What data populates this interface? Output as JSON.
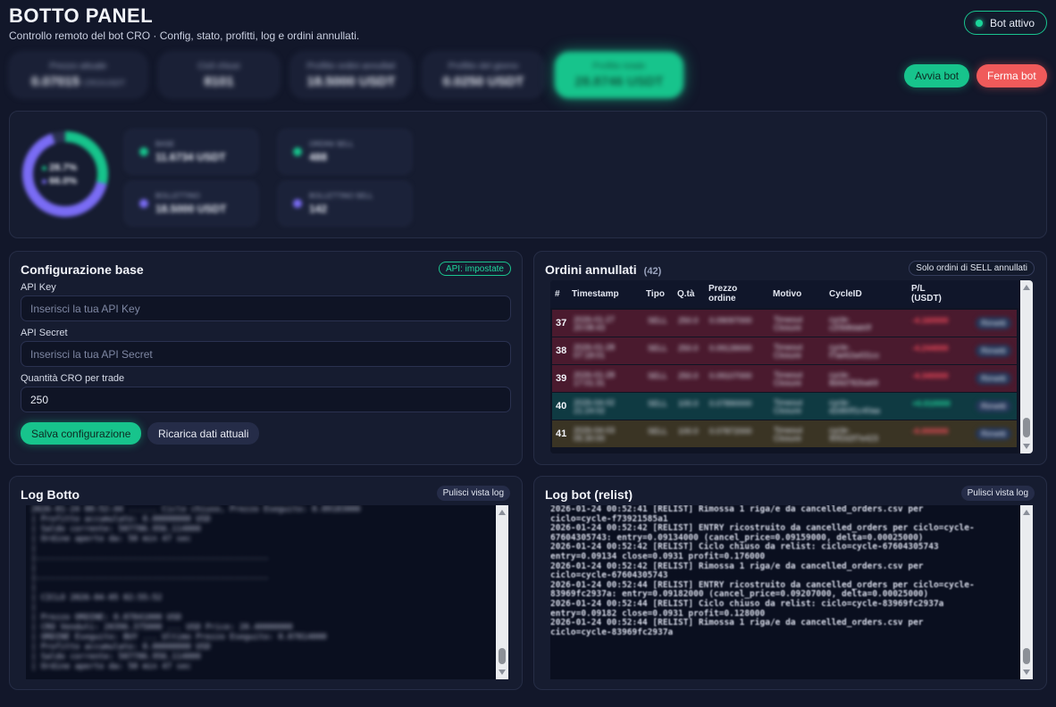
{
  "header": {
    "title": "BOTTO PANEL",
    "subtitle": "Controllo remoto del bot CRO · Config, stato, profitti, log e ordini annullati.",
    "status_label": "Bot attivo"
  },
  "stats": [
    {
      "label": "Prezzo attuale",
      "value": "0.07015",
      "unit": "CRO/USDT",
      "highlight": false
    },
    {
      "label": "Cicli chiusi",
      "value": "8101",
      "unit": "",
      "highlight": false
    },
    {
      "label": "Profitto ordini annullati",
      "value": "18.5000 USDT",
      "unit": "",
      "highlight": false
    },
    {
      "label": "Profitto del giorno",
      "value": "0.0250 USDT",
      "unit": "",
      "highlight": false
    },
    {
      "label": "Profitto totale",
      "value": "28.8746 USDT",
      "unit": "",
      "highlight": true
    }
  ],
  "actions": {
    "start_label": "Avvia bot",
    "stop_label": "Ferma bot"
  },
  "distribution": {
    "pct_a": "28.7%",
    "pct_b": "66.0%",
    "fraction_a": 0.287,
    "fraction_b": 0.66,
    "cards": [
      {
        "label": "BASE",
        "value": "11.6734 USDT",
        "color": "#17c48c"
      },
      {
        "label": "ORDINI SELL",
        "value": "488",
        "color": "#17c48c"
      },
      {
        "label": "BOLLETTINO",
        "value": "18.5000 USDT",
        "color": "#7a6cf5"
      },
      {
        "label": "BOLLETTINO SELL",
        "value": "142",
        "color": "#7a6cf5"
      }
    ]
  },
  "config": {
    "title": "Configurazione base",
    "api_badge": "API: impostate",
    "api_key_label": "API Key",
    "api_key_placeholder": "Inserisci la tua API Key",
    "api_secret_label": "API Secret",
    "api_secret_placeholder": "Inserisci la tua API Secret",
    "qty_label": "Quantità CRO per trade",
    "qty_value": "250",
    "save_label": "Salva configurazione",
    "reload_label": "Ricarica dati attuali"
  },
  "orders": {
    "title": "Ordini annullati",
    "count": "(42)",
    "filter_label": "Solo ordini di SELL annullati",
    "columns": [
      "#",
      "Timestamp",
      "Tipo",
      "Q.tà",
      "Prezzo ordine",
      "Motivo",
      "CycleID",
      "P/L (USDT)"
    ],
    "rows": [
      {
        "id": "37",
        "ts": "2026-01-27 20:08:43",
        "tipo": "SELL",
        "qty": "250.0",
        "price": "0.09097000",
        "motivo": "Timeout Closure",
        "cycle": "cycle-c20b8dab0f",
        "pl": "-4.160000",
        "action": "Rimetti",
        "bg": "#4a1a2e",
        "pl_color": "#ff4d5e"
      },
      {
        "id": "38",
        "ts": "2026-01-28 07:18:01",
        "tipo": "SELL",
        "qty": "250.0",
        "price": "0.09139000",
        "motivo": "Timeout Closure",
        "cycle": "cycle-f7ae62a431cc",
        "pl": "-4.244000",
        "action": "Rimetti",
        "bg": "#4a1a2e",
        "pl_color": "#ff4d5e"
      },
      {
        "id": "39",
        "ts": "2026-01-28 17:01:31",
        "tipo": "SELL",
        "qty": "250.0",
        "price": "0.09107000",
        "motivo": "Timeout Closure",
        "cycle": "cycle-8d4d782ba69",
        "pl": "-4.340000",
        "action": "Rimetti",
        "bg": "#4a1a2e",
        "pl_color": "#ff4d5e"
      },
      {
        "id": "40",
        "ts": "2026-04-02 21:24:02",
        "tipo": "SELL",
        "qty": "100.0",
        "price": "0.07890000",
        "motivo": "Timeout Closure",
        "cycle": "cycle-d2d60f1c40aa",
        "pl": "+0.010000",
        "action": "Rimetti",
        "bg": "#0f3a42",
        "pl_color": "#22e0a0"
      },
      {
        "id": "41",
        "ts": "2026-04-03 05:30:00",
        "tipo": "SELL",
        "qty": "100.0",
        "price": "0.07872000",
        "motivo": "Timeout Closure",
        "cycle": "cycle-90f2d2f7e423",
        "pl": "-0.000000",
        "action": "Rimetti",
        "bg": "#3a3424",
        "pl_color": "#ff4d5e"
      }
    ]
  },
  "log_bot": {
    "title": "Log Botto",
    "clear_label": "Pulisci vista log",
    "lines": [
      "2026-01-24 00:52:44 ...... Ciclo chiuso, Prezzo Eseguito: 0.09183000",
      "| Profitto accumulato: 0.00000000 USD",
      "| Saldo corrente: 507786.956.114000",
      "| Ordine aperto da: 50 min 47 sec",
      "|",
      "|------------------------------------------------",
      "|",
      "|------------------------------------------------",
      "|",
      "| CICLO 2026-04-05 02:55:52",
      "|",
      "| Prezzo ORDINE: 0.07841000 USD",
      "| CRO Venduti: 20396.375000 ... USD Price: 20.40000000",
      "| ORDINE Eseguito: BUY ... Ultimo Prezzo Eseguito: 0.07814000",
      "| Profitto accumulato: 0.00000000 USD",
      "| Saldo corrente: 507786.956.114000",
      "| Ordine aperto da: 50 min 47 sec"
    ]
  },
  "log_relist": {
    "title": "Log bot (relist)",
    "clear_label": "Pulisci vista log",
    "text": "2026-01-24 00:52:41 [RELIST] Rimossa 1 riga/e da cancelled_orders.csv per\nciclo=cycle-f73921585a1\n2026-01-24 00:52:42 [RELIST] ENTRY ricostruito da cancelled_orders per ciclo=cycle-\n67604305743: entry=0.09134000 (cancel_price=0.09159000, delta=0.00025000)\n2026-01-24 00:52:42 [RELIST] Ciclo chiuso da relist: ciclo=cycle-67604305743\nentry=0.09134 close=0.0931 profit=0.176000\n2026-01-24 00:52:42 [RELIST] Rimossa 1 riga/e da cancelled_orders.csv per\nciclo=cycle-67604305743\n2026-01-24 00:52:44 [RELIST] ENTRY ricostruito da cancelled_orders per ciclo=cycle-\n83969fc2937a: entry=0.09182000 (cancel_price=0.09207000, delta=0.00025000)\n2026-01-24 00:52:44 [RELIST] Ciclo chiuso da relist: ciclo=cycle-83969fc2937a\nentry=0.09182 close=0.0931 profit=0.128000\n2026-01-24 00:52:44 [RELIST] Rimossa 1 riga/e da cancelled_orders.csv per\nciclo=cycle-83969fc2937a"
  },
  "colors": {
    "accent": "#17c48c",
    "danger": "#f05a5a",
    "purple": "#7a6cf5",
    "bg": "#12172a",
    "panel": "#161c30"
  }
}
